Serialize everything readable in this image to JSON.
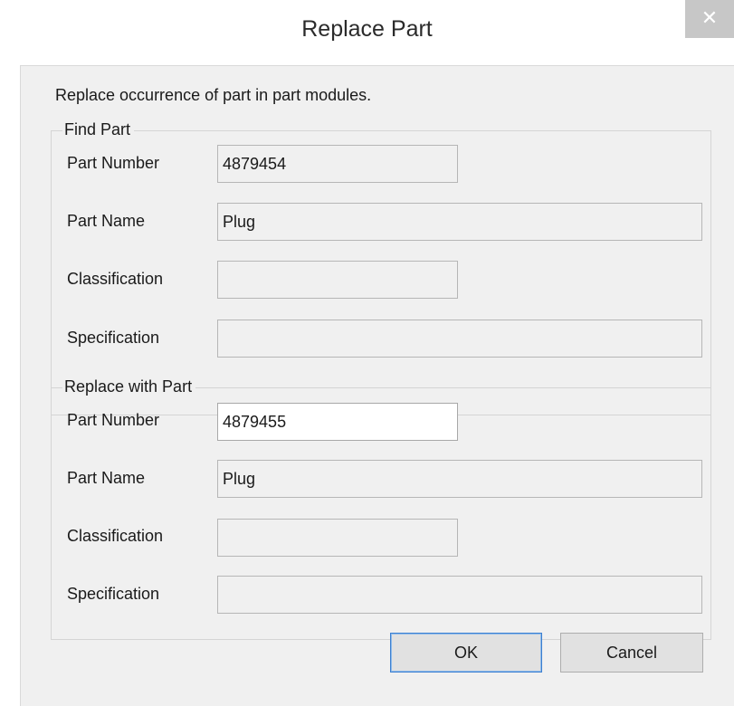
{
  "window": {
    "title": "Replace Part",
    "close_glyph": "✕"
  },
  "description": "Replace occurrence of part in part modules.",
  "find_group": {
    "legend": "Find Part",
    "part_number_label": "Part Number",
    "part_number_value": "4879454",
    "part_name_label": "Part Name",
    "part_name_value": "Plug",
    "classification_label": "Classification",
    "classification_value": "",
    "specification_label": "Specification",
    "specification_value": ""
  },
  "replace_group": {
    "legend": "Replace with Part",
    "part_number_label": "Part Number",
    "part_number_value": "4879455",
    "part_name_label": "Part Name",
    "part_name_value": "Plug",
    "classification_label": "Classification",
    "classification_value": "",
    "specification_label": "Specification",
    "specification_value": ""
  },
  "buttons": {
    "ok_label": "OK",
    "cancel_label": "Cancel"
  },
  "icons": {
    "close": "close-icon"
  }
}
